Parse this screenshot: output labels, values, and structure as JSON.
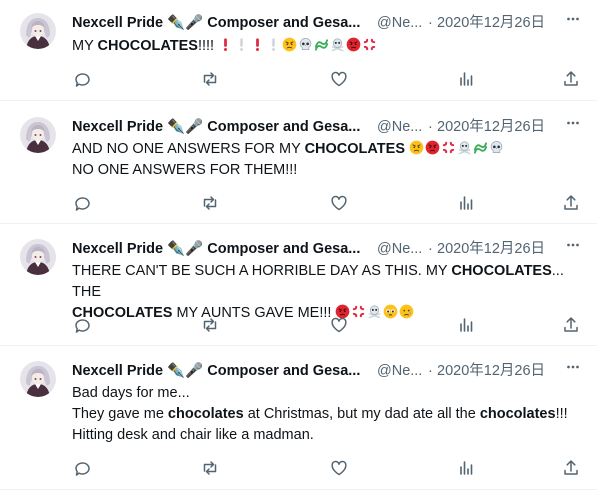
{
  "tweets": [
    {
      "name": "Nexcell Pride ✒️🎤 Composer and Gesa...",
      "handle": "@Ne...",
      "dot": "·",
      "time": "2020年12月26日",
      "lines": [
        [
          {
            "t": "MY "
          },
          {
            "t": "CHOCOLATES",
            "b": true
          },
          {
            "t": "!!!! "
          }
        ]
      ],
      "emoji_tail": [
        "red-exclamation",
        "grey-exclamation",
        "red-exclamation",
        "grey-exclamation",
        "angry-face",
        "skull",
        "wave",
        "skull-crossbones",
        "rage-face",
        "anger-symbol"
      ]
    },
    {
      "name": "Nexcell Pride ✒️🎤 Composer and Gesa...",
      "handle": "@Ne...",
      "dot": "·",
      "time": "2020年12月26日",
      "lines": [
        [
          {
            "t": "AND NO ONE ANSWERS FOR MY "
          },
          {
            "t": "CHOCOLATES",
            "b": true
          },
          {
            "t": " "
          }
        ],
        [
          {
            "t": "NO ONE ANSWERS FOR THEM!!!"
          }
        ]
      ],
      "emoji_tail": [
        "angry-face",
        "rage-face",
        "anger-symbol",
        "skull-crossbones",
        "wave",
        "skull"
      ]
    },
    {
      "name": "Nexcell Pride ✒️🎤 Composer and Gesa...",
      "handle": "@Ne...",
      "dot": "·",
      "time": "2020年12月26日",
      "lines": [
        [
          {
            "t": "THERE CAN'T BE SUCH A HORRIBLE DAY AS THIS. MY "
          },
          {
            "t": "CHOCOLATES",
            "b": true
          },
          {
            "t": "... THE"
          }
        ],
        [
          {
            "t": "CHOCOLATES",
            "b": true
          },
          {
            "t": " MY AUNTS GAVE ME!!! "
          }
        ]
      ],
      "emoji_tail": [
        "rage-face",
        "anger-symbol",
        "skull-crossbones",
        "pleading-face",
        "crying-face"
      ]
    },
    {
      "name": "Nexcell Pride ✒️🎤 Composer and Gesa...",
      "handle": "@Ne...",
      "dot": "·",
      "time": "2020年12月26日",
      "lines": [
        [
          {
            "t": "Bad days for me..."
          }
        ],
        [
          {
            "t": "They gave me "
          },
          {
            "t": "chocolates",
            "b": true
          },
          {
            "t": " at Christmas, but my dad ate all the "
          },
          {
            "t": "chocolates",
            "b": true
          },
          {
            "t": "!!!"
          }
        ],
        [
          {
            "t": "Hitting desk and chair like a madman."
          }
        ]
      ],
      "emoji_tail": []
    }
  ],
  "actions": [
    "reply-icon",
    "retweet-icon",
    "like-icon",
    "views-icon",
    "share-icon"
  ],
  "colors": {
    "text": "#0f1419",
    "muted": "#536471",
    "divider": "#eff3f4",
    "icon": "#536471"
  }
}
